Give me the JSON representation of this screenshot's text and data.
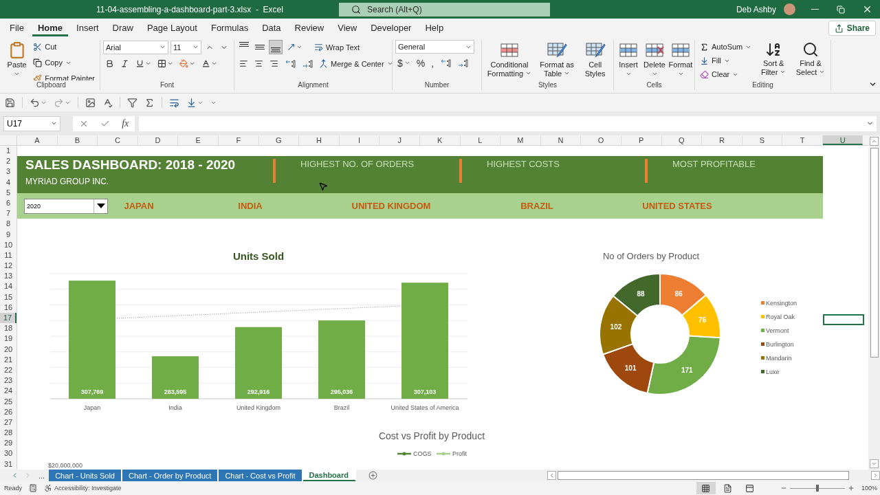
{
  "window": {
    "title": "11-04-assembling-a-dashboard-part-3.xlsx  -  Excel",
    "search_placeholder": "Search (Alt+Q)",
    "user": "Deb Ashby"
  },
  "menu_tabs": [
    {
      "label": "File",
      "selected": false
    },
    {
      "label": "Home",
      "selected": true
    },
    {
      "label": "Insert",
      "selected": false
    },
    {
      "label": "Draw",
      "selected": false
    },
    {
      "label": "Page Layout",
      "selected": false
    },
    {
      "label": "Formulas",
      "selected": false
    },
    {
      "label": "Data",
      "selected": false
    },
    {
      "label": "Review",
      "selected": false
    },
    {
      "label": "View",
      "selected": false
    },
    {
      "label": "Developer",
      "selected": false
    },
    {
      "label": "Help",
      "selected": false
    }
  ],
  "share": "Share",
  "ribbon": [
    {
      "kind": "clipboard",
      "title": "Clipboard",
      "paste": "Paste",
      "cut": "Cut",
      "copy": "Copy",
      "painter": "Format Painter"
    },
    {
      "kind": "font",
      "title": "Font",
      "font": "Arial",
      "size": "11"
    },
    {
      "kind": "alignment",
      "title": "Alignment",
      "vertical": [
        {
          "selected": false
        },
        {
          "selected": false
        },
        {
          "selected": true
        }
      ],
      "wrap": "Wrap Text",
      "merge": "Merge & Center"
    },
    {
      "kind": "number",
      "title": "Number",
      "format": "General",
      "currency": "$",
      "percent": "%",
      "comma": ","
    },
    {
      "kind": "styles",
      "title": "Styles",
      "buttons": [
        "Conditional Formatting",
        "Format as Table",
        "Cell Styles"
      ]
    },
    {
      "kind": "cells",
      "title": "Cells",
      "buttons": [
        "Insert",
        "Delete",
        "Format"
      ]
    },
    {
      "kind": "editing",
      "title": "Editing",
      "autosum": "AutoSum",
      "fill": "Fill",
      "clear": "Clear",
      "buttons": [
        "Sort & Filter",
        "Find & Select"
      ]
    }
  ],
  "formula_bar": {
    "name_box": "U17",
    "fx": "fx"
  },
  "columns": [
    {
      "label": "A",
      "selected": false
    },
    {
      "label": "B",
      "selected": false
    },
    {
      "label": "C",
      "selected": false
    },
    {
      "label": "D",
      "selected": false
    },
    {
      "label": "E",
      "selected": false
    },
    {
      "label": "F",
      "selected": false
    },
    {
      "label": "G",
      "selected": false
    },
    {
      "label": "H",
      "selected": false
    },
    {
      "label": "I",
      "selected": false
    },
    {
      "label": "J",
      "selected": false
    },
    {
      "label": "K",
      "selected": false
    },
    {
      "label": "L",
      "selected": false
    },
    {
      "label": "M",
      "selected": false
    },
    {
      "label": "N",
      "selected": false
    },
    {
      "label": "O",
      "selected": false
    },
    {
      "label": "P",
      "selected": false
    },
    {
      "label": "Q",
      "selected": false
    },
    {
      "label": "R",
      "selected": false
    },
    {
      "label": "S",
      "selected": false
    },
    {
      "label": "T",
      "selected": false
    },
    {
      "label": "U",
      "selected": true
    }
  ],
  "rows": [
    {
      "label": "1",
      "selected": false
    },
    {
      "label": "2",
      "selected": false
    },
    {
      "label": "3",
      "selected": false
    },
    {
      "label": "4",
      "selected": false
    },
    {
      "label": "5",
      "selected": false
    },
    {
      "label": "6",
      "selected": false
    },
    {
      "label": "7",
      "selected": false
    },
    {
      "label": "8",
      "selected": false
    },
    {
      "label": "9",
      "selected": false
    },
    {
      "label": "10",
      "selected": false
    },
    {
      "label": "11",
      "selected": false
    },
    {
      "label": "12",
      "selected": false
    },
    {
      "label": "13",
      "selected": false
    },
    {
      "label": "14",
      "selected": false
    },
    {
      "label": "15",
      "selected": false
    },
    {
      "label": "16",
      "selected": false
    },
    {
      "label": "17",
      "selected": true
    },
    {
      "label": "18",
      "selected": false
    },
    {
      "label": "19",
      "selected": false
    },
    {
      "label": "20",
      "selected": false
    },
    {
      "label": "21",
      "selected": false
    },
    {
      "label": "22",
      "selected": false
    },
    {
      "label": "23",
      "selected": false
    },
    {
      "label": "24",
      "selected": false
    },
    {
      "label": "25",
      "selected": false
    },
    {
      "label": "26",
      "selected": false
    },
    {
      "label": "27",
      "selected": false
    },
    {
      "label": "28",
      "selected": false
    },
    {
      "label": "29",
      "selected": false
    },
    {
      "label": "30",
      "selected": false
    },
    {
      "label": "31",
      "selected": false
    }
  ],
  "dashboard": {
    "title": "SALES DASHBOARD: 2018 - 2020",
    "subtitle": "MYRIAD GROUP INC.",
    "kpis": [
      "HIGHEST NO. OF ORDERS",
      "HIGHEST COSTS",
      "MOST PROFITABLE"
    ],
    "year": "2020",
    "countries": [
      "JAPAN",
      "INDIA",
      "UNITED KINGDOM",
      "BRAZIL",
      "UNITED STATES"
    ]
  },
  "units_chart": {
    "chart_data": {
      "type": "bar",
      "title": "Units Sold",
      "categories": [
        "Japan",
        "India",
        "United Kingdom",
        "Brazil",
        "United States of America"
      ],
      "values": [
        307769,
        283595,
        292916,
        295036,
        307103
      ],
      "ylim": [
        270000,
        310000
      ],
      "value_labels": [
        "307,769",
        "283,595",
        "292,916",
        "295,036",
        "307,103"
      ]
    },
    "connector": {
      "kind": "dotted"
    }
  },
  "orders_chart": {
    "chart_data": {
      "type": "donut",
      "title": "No of Orders by Product",
      "categories": [
        "Kensington",
        "Royal Oak",
        "Vermont",
        "Burlington",
        "Mandarin",
        "Luxe"
      ],
      "values": [
        86,
        76,
        171,
        101,
        102,
        88
      ],
      "data_labels": true,
      "legend": "right"
    },
    "slices": [
      {
        "color": "#ed7d31"
      },
      {
        "color": "#ffc000"
      },
      {
        "color": "#70ad47"
      },
      {
        "color": "#9e480e"
      },
      {
        "color": "#997300"
      },
      {
        "color": "#43682b"
      }
    ]
  },
  "cost_chart": {
    "title": "Cost vs Profit by Product",
    "legend": [
      {
        "label": "COGS",
        "color": "#548235"
      },
      {
        "label": "Profit",
        "color": "#a9d18e"
      }
    ],
    "axis_label": "$20,000,000"
  },
  "sheet_tabs": {
    "more": "...",
    "tabs": [
      {
        "label": "Chart - Units Sold",
        "selected": false,
        "color": "#2e75b6"
      },
      {
        "label": "Chart - Order by Product",
        "selected": false,
        "color": "#2e75b6"
      },
      {
        "label": "Chart - Cost vs Profit",
        "selected": false,
        "color": "#2e75b6"
      },
      {
        "label": "Dashboard",
        "selected": true
      }
    ]
  },
  "status_bar": {
    "ready": "Ready",
    "accessibility": "Accessibility: Investigate",
    "views": [
      {
        "selected": true
      },
      {
        "selected": false
      },
      {
        "selected": false
      }
    ],
    "zoom": {
      "level": 0.5
    },
    "zoom_reading": "100%"
  }
}
